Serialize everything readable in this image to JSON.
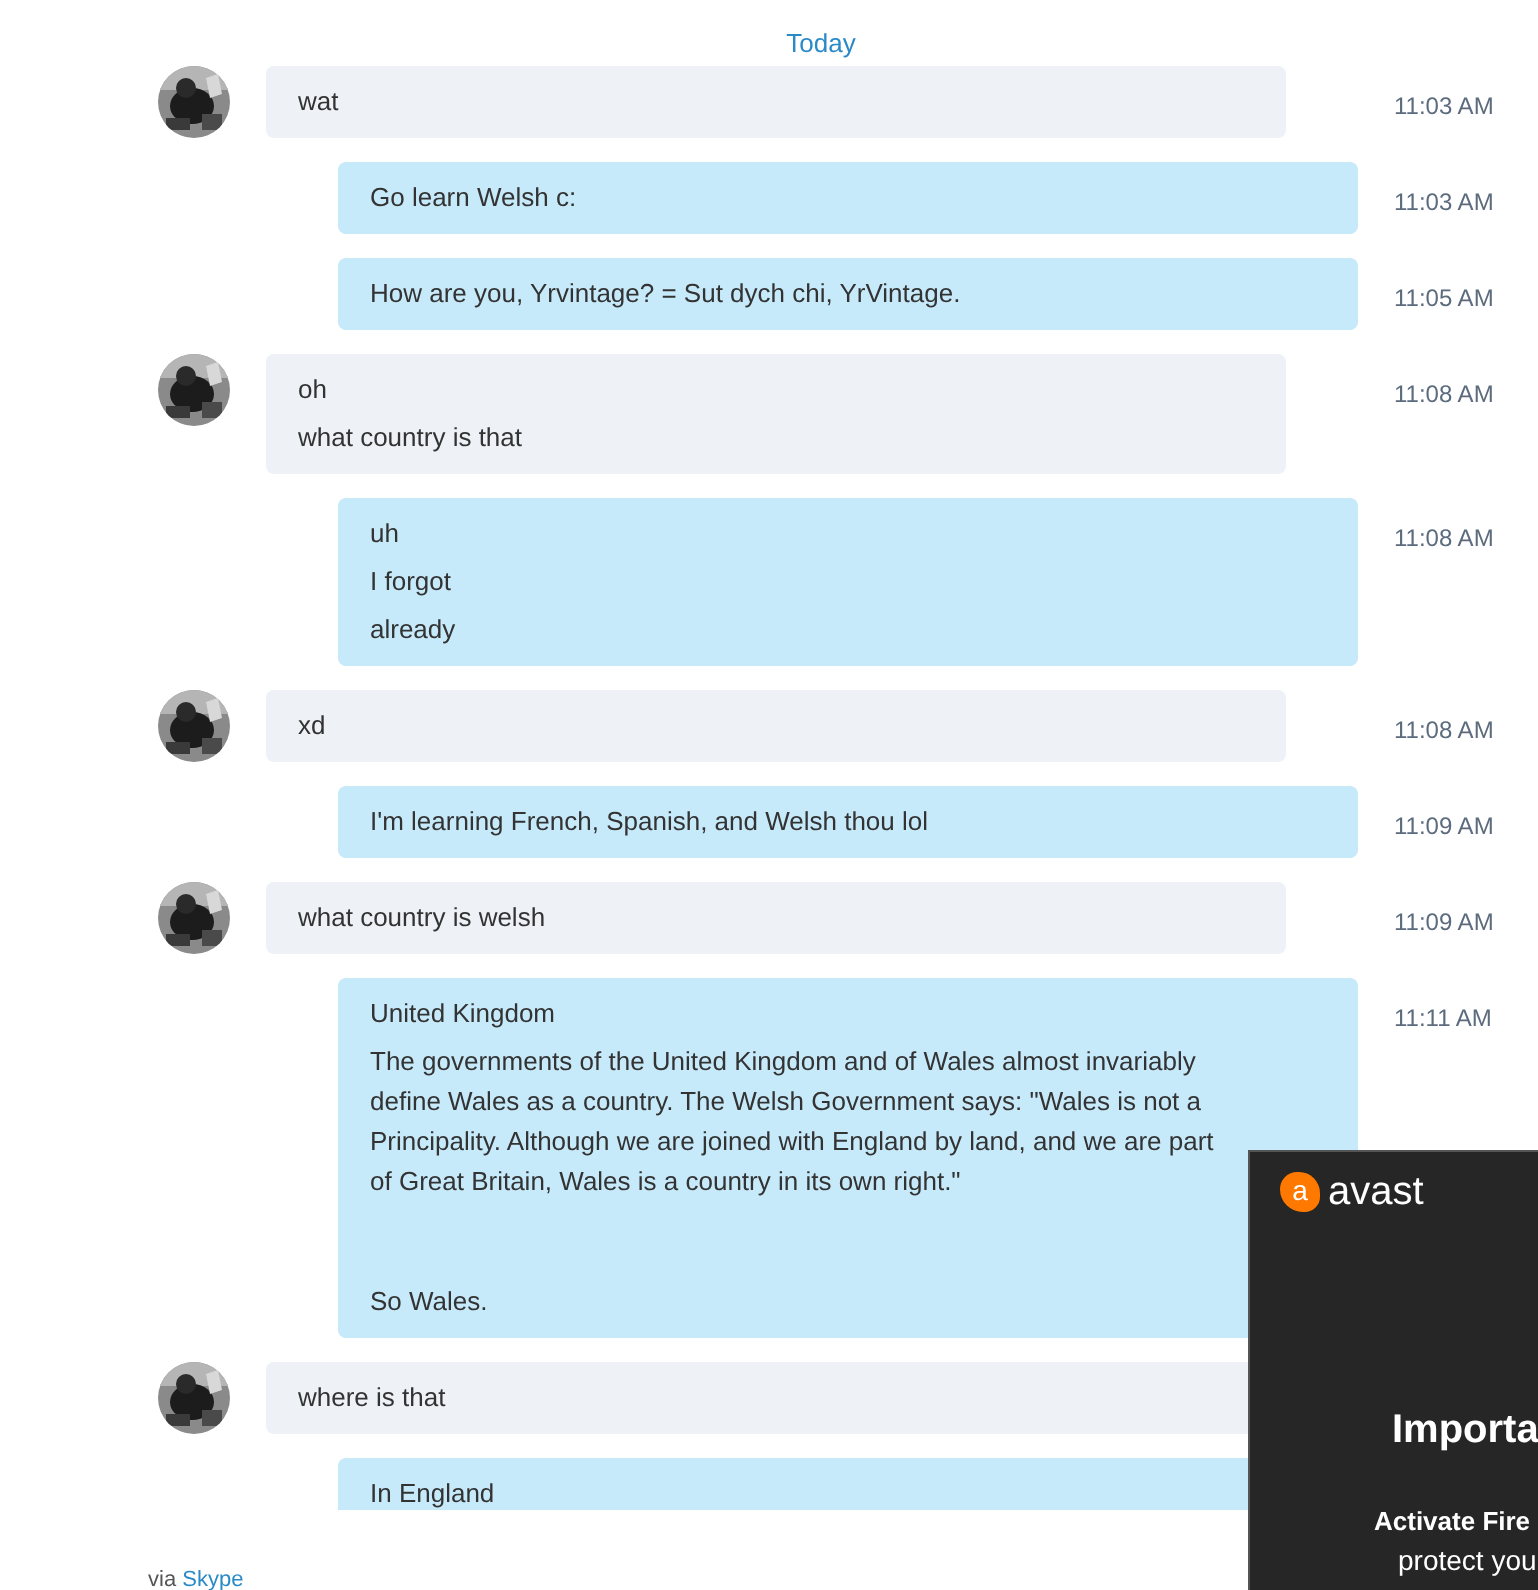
{
  "header": {
    "date": "Today"
  },
  "messages": [
    {
      "kind": "incoming",
      "paragraphs": [
        [
          "wat"
        ]
      ],
      "time": "11:03 AM"
    },
    {
      "kind": "outgoing",
      "paragraphs": [
        [
          "Go learn Welsh c:"
        ]
      ],
      "time": "11:03 AM"
    },
    {
      "kind": "outgoing",
      "paragraphs": [
        [
          "How are you, Yrvintage? = Sut dych chi, YrVintage."
        ]
      ],
      "time": "11:05 AM"
    },
    {
      "kind": "incoming",
      "paragraphs": [
        [
          "oh",
          "what country is that"
        ]
      ],
      "time": "11:08 AM"
    },
    {
      "kind": "outgoing",
      "paragraphs": [
        [
          "uh",
          "I forgot",
          "already"
        ]
      ],
      "time": "11:08 AM"
    },
    {
      "kind": "incoming",
      "paragraphs": [
        [
          "xd"
        ]
      ],
      "time": "11:08 AM"
    },
    {
      "kind": "outgoing",
      "paragraphs": [
        [
          "I'm learning French, Spanish, and Welsh thou lol"
        ]
      ],
      "time": "11:09 AM"
    },
    {
      "kind": "incoming",
      "paragraphs": [
        [
          "what country is welsh"
        ]
      ],
      "time": "11:09 AM"
    },
    {
      "kind": "outgoing",
      "paragraphs": [
        [
          "United Kingdom",
          "The governments of the United Kingdom and of Wales almost invariably define Wales as a country. The Welsh Government says: \"Wales is not a Principality. Although we are joined with England by land, and we are part of Great Britain, Wales is a country in its own right.\""
        ],
        [
          "So Wales."
        ]
      ],
      "time": "11:11 AM"
    },
    {
      "kind": "incoming",
      "paragraphs": [
        [
          "where is that"
        ]
      ]
    },
    {
      "kind": "outgoing",
      "paragraphs": [
        [
          "In England"
        ]
      ]
    }
  ],
  "footer": {
    "prefix": "via",
    "link": "Skype"
  },
  "popup": {
    "logo_mark": "a",
    "brand": "avast",
    "heading": "Importa",
    "subheading": "Activate Fire",
    "body": "protect you"
  }
}
